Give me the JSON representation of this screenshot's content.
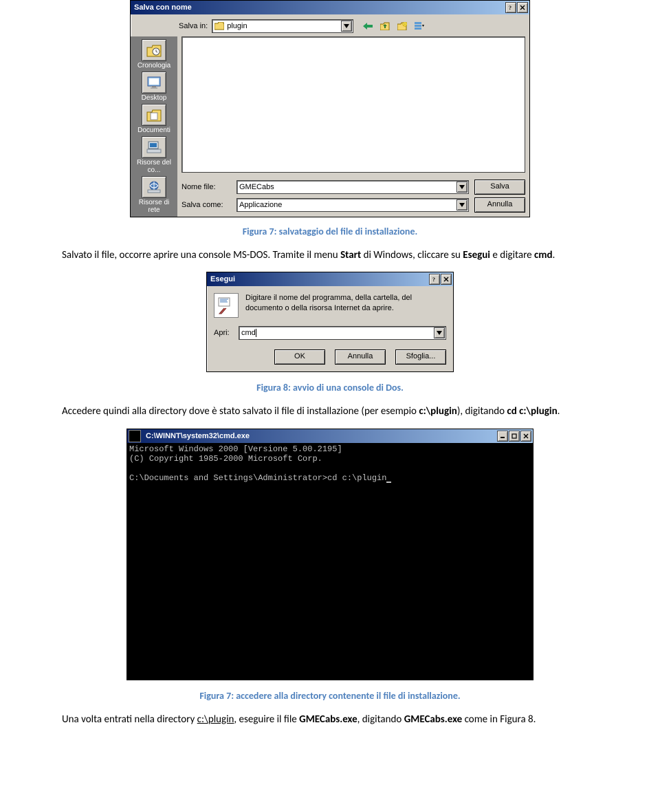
{
  "save_dialog": {
    "title": "Salva con nome",
    "save_in_label": "Salva in:",
    "save_in_value": "plugin",
    "places": {
      "cronologia": "Cronologia",
      "desktop": "Desktop",
      "documenti": "Documenti",
      "risorse_computer": "Risorse del co...",
      "risorse_rete": "Risorse di rete"
    },
    "filename_label": "Nome file:",
    "filename_value": "GMECabs",
    "save_as_label": "Salva come:",
    "save_as_value": "Applicazione",
    "save_button": "Salva",
    "cancel_button": "Annulla"
  },
  "caption1": "Figura 7: salvataggio del file di installazione.",
  "para1_pre": "Salvato il file, occorre aprire una console MS-DOS. Tramite il menu ",
  "para1_b1": "Start",
  "para1_mid": " di Windows, cliccare su ",
  "para1_b2": "Esegui",
  "para1_mid2": " e digitare ",
  "para1_b3": "cmd",
  "para1_post": ".",
  "run_dialog": {
    "title": "Esegui",
    "description": "Digitare il nome del programma, della cartella, del documento o della risorsa Internet da aprire.",
    "apri_label": "Apri:",
    "apri_value": "cmd",
    "ok": "OK",
    "annulla": "Annulla",
    "sfoglia": "Sfoglia..."
  },
  "caption2": "Figura 8: avvio di una console di Dos.",
  "para2_pre": "Accedere quindi alla directory dove è stato salvato il file di installazione (per esempio ",
  "para2_b1": "c:\\plugin",
  "para2_mid": "), digitando ",
  "para2_b2": "cd c:\\plugin",
  "para2_post": ".",
  "cmd_window": {
    "title": "C:\\WINNT\\system32\\cmd.exe",
    "line1": "Microsoft Windows 2000 [Versione 5.00.2195]",
    "line2": "(C) Copyright 1985-2000 Microsoft Corp.",
    "prompt": "C:\\Documents and Settings\\Administrator>",
    "typed": "cd c:\\plugin"
  },
  "caption3": "Figura 7: accedere alla directory contenente il file di installazione.",
  "para3_pre": "Una volta entrati nella directory ",
  "para3_u1": "c:\\plugin",
  "para3_mid": ", eseguire il file ",
  "para3_b1": "GMECabs.exe",
  "para3_mid2": ", digitando ",
  "para3_b2": "GMECabs.exe",
  "para3_post": " come in Figura 8."
}
